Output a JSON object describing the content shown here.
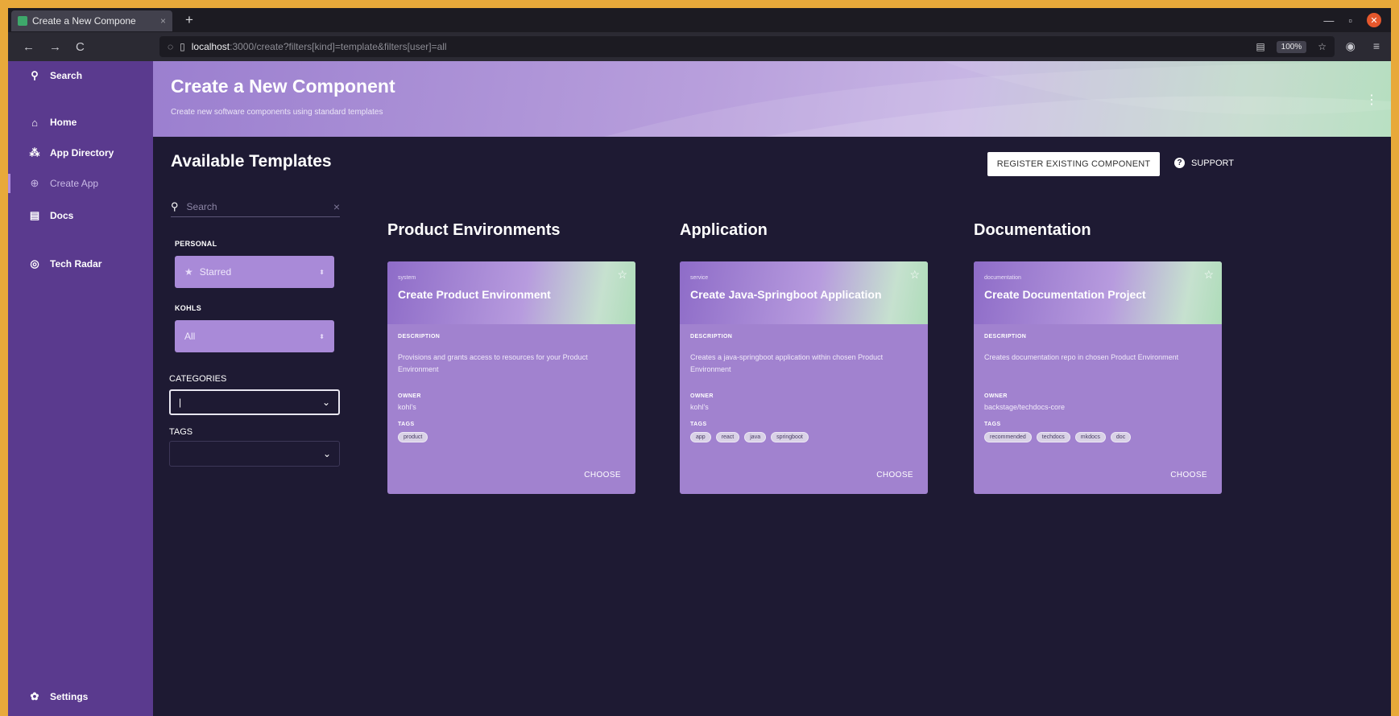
{
  "browser": {
    "tab_title": "Create a New Compone",
    "tab_close": "×",
    "new_tab": "+",
    "url_host": "localhost",
    "url_rest": ":3000/create?filters[kind]=template&filters[user]=all",
    "zoom": "100%",
    "back": "←",
    "forward": "→",
    "reload": "C"
  },
  "sidebar": {
    "items": [
      {
        "label": "Search",
        "icon": "search-icon"
      },
      {
        "label": "Home",
        "icon": "home-icon"
      },
      {
        "label": "App Directory",
        "icon": "app-directory-icon"
      },
      {
        "label": "Create App",
        "icon": "create-app-icon"
      },
      {
        "label": "Docs",
        "icon": "docs-icon"
      },
      {
        "label": "Tech Radar",
        "icon": "tech-radar-icon"
      },
      {
        "label": "Settings",
        "icon": "gear-icon"
      }
    ]
  },
  "header": {
    "title": "Create a New Component",
    "subtitle": "Create new software components using standard templates"
  },
  "content": {
    "section_title": "Available Templates",
    "register_button": "REGISTER EXISTING COMPONENT",
    "support_label": "SUPPORT"
  },
  "filters": {
    "search_placeholder": "Search",
    "personal_label": "PERSONAL",
    "personal_value": "Starred",
    "org_label": "KOHLS",
    "org_value": "All",
    "categories_label": "CATEGORIES",
    "categories_value": "|",
    "tags_label": "TAGS"
  },
  "columns": [
    {
      "title": "Product Environments",
      "card": {
        "kind": "system",
        "title": "Create Product Environment",
        "description_label": "DESCRIPTION",
        "description": "Provisions and grants access to resources for your Product Environment",
        "owner_label": "OWNER",
        "owner": "kohl's",
        "tags_label": "TAGS",
        "tags": [
          "product"
        ],
        "choose": "CHOOSE"
      }
    },
    {
      "title": "Application",
      "card": {
        "kind": "service",
        "title": "Create Java-Springboot Application",
        "description_label": "DESCRIPTION",
        "description": "Creates a java-springboot application within chosen Product Environment",
        "owner_label": "OWNER",
        "owner": "kohl's",
        "tags_label": "TAGS",
        "tags": [
          "app",
          "react",
          "java",
          "springboot"
        ],
        "choose": "CHOOSE"
      }
    },
    {
      "title": "Documentation",
      "card": {
        "kind": "documentation",
        "title": "Create Documentation Project",
        "description_label": "DESCRIPTION",
        "description": "Creates documentation repo in chosen Product Environment",
        "owner_label": "OWNER",
        "owner": "backstage/techdocs-core",
        "tags_label": "TAGS",
        "tags": [
          "recommended",
          "techdocs",
          "mkdocs",
          "doc"
        ],
        "choose": "CHOOSE"
      }
    }
  ]
}
